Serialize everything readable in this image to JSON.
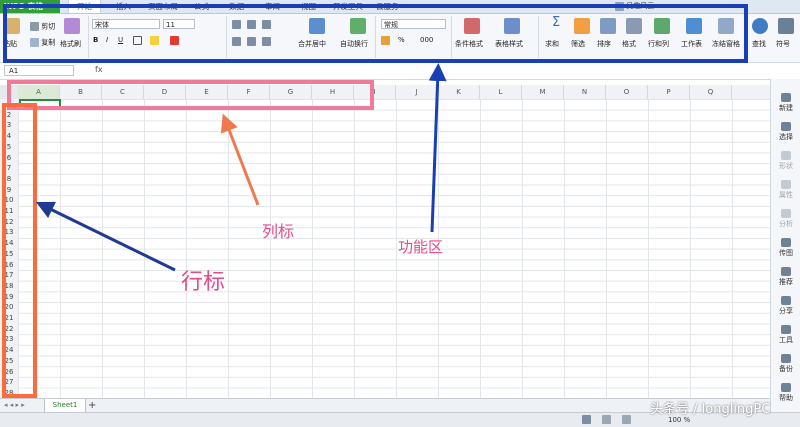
{
  "app": {
    "logo": "WPS 表格"
  },
  "menu": [
    "开始",
    "插入",
    "页面布局",
    "公式",
    "数据",
    "审阅",
    "视图",
    "开发工具",
    "云服务"
  ],
  "user": "吴趣风云",
  "ribbon": {
    "paste": "粘贴",
    "cut": "剪切",
    "copy": "复制",
    "format_painter": "格式刷",
    "font_name": "宋体",
    "font_size": "11",
    "bold": "B",
    "italic": "I",
    "underline": "U",
    "merge_center": "合并居中",
    "wrap_text": "自动换行",
    "number_format": "常规",
    "percent": "%",
    "thousands": "000",
    "cond_format": "条件格式",
    "table_style": "表格样式",
    "sum": "求和",
    "filter": "筛选",
    "sort": "排序",
    "format": "格式",
    "row_col": "行和列",
    "worksheet": "工作表",
    "freeze": "冻结窗格",
    "find": "查找",
    "symbol": "符号"
  },
  "formula_bar": {
    "name_box": "A1",
    "fx": "fx"
  },
  "columns": [
    "A",
    "B",
    "C",
    "D",
    "E",
    "F",
    "G",
    "H",
    "I",
    "J",
    "K",
    "L",
    "M",
    "N",
    "O",
    "P",
    "Q"
  ],
  "rows": [
    "1",
    "2",
    "3",
    "4",
    "5",
    "6",
    "7",
    "8",
    "9",
    "10",
    "11",
    "12",
    "13",
    "14",
    "15",
    "16",
    "17",
    "18",
    "19",
    "20",
    "21",
    "22",
    "23",
    "24",
    "25",
    "26",
    "27",
    "28"
  ],
  "sheet_tabs": {
    "active": "Sheet1",
    "add": "+"
  },
  "status": {
    "zoom": "100 %"
  },
  "right_pane": [
    "新建",
    "选择",
    "形状",
    "属性",
    "分析",
    "传图",
    "推荐",
    "分享",
    "工具",
    "备份",
    "帮助"
  ],
  "right_pane_dim": [
    false,
    false,
    true,
    true,
    true,
    false,
    false,
    false,
    false,
    false,
    false
  ],
  "annotations": {
    "column_header": "列标",
    "row_header": "行标",
    "ribbon": "功能区"
  },
  "watermark": "头条号 / longlingPC",
  "colors": {
    "logo_green": "#2f9e3a",
    "ribbon_box": "#1a3fb5",
    "col_box": "#f07a9a",
    "row_box": "#ff6a3d",
    "annotation_text": "#e44c8c"
  }
}
